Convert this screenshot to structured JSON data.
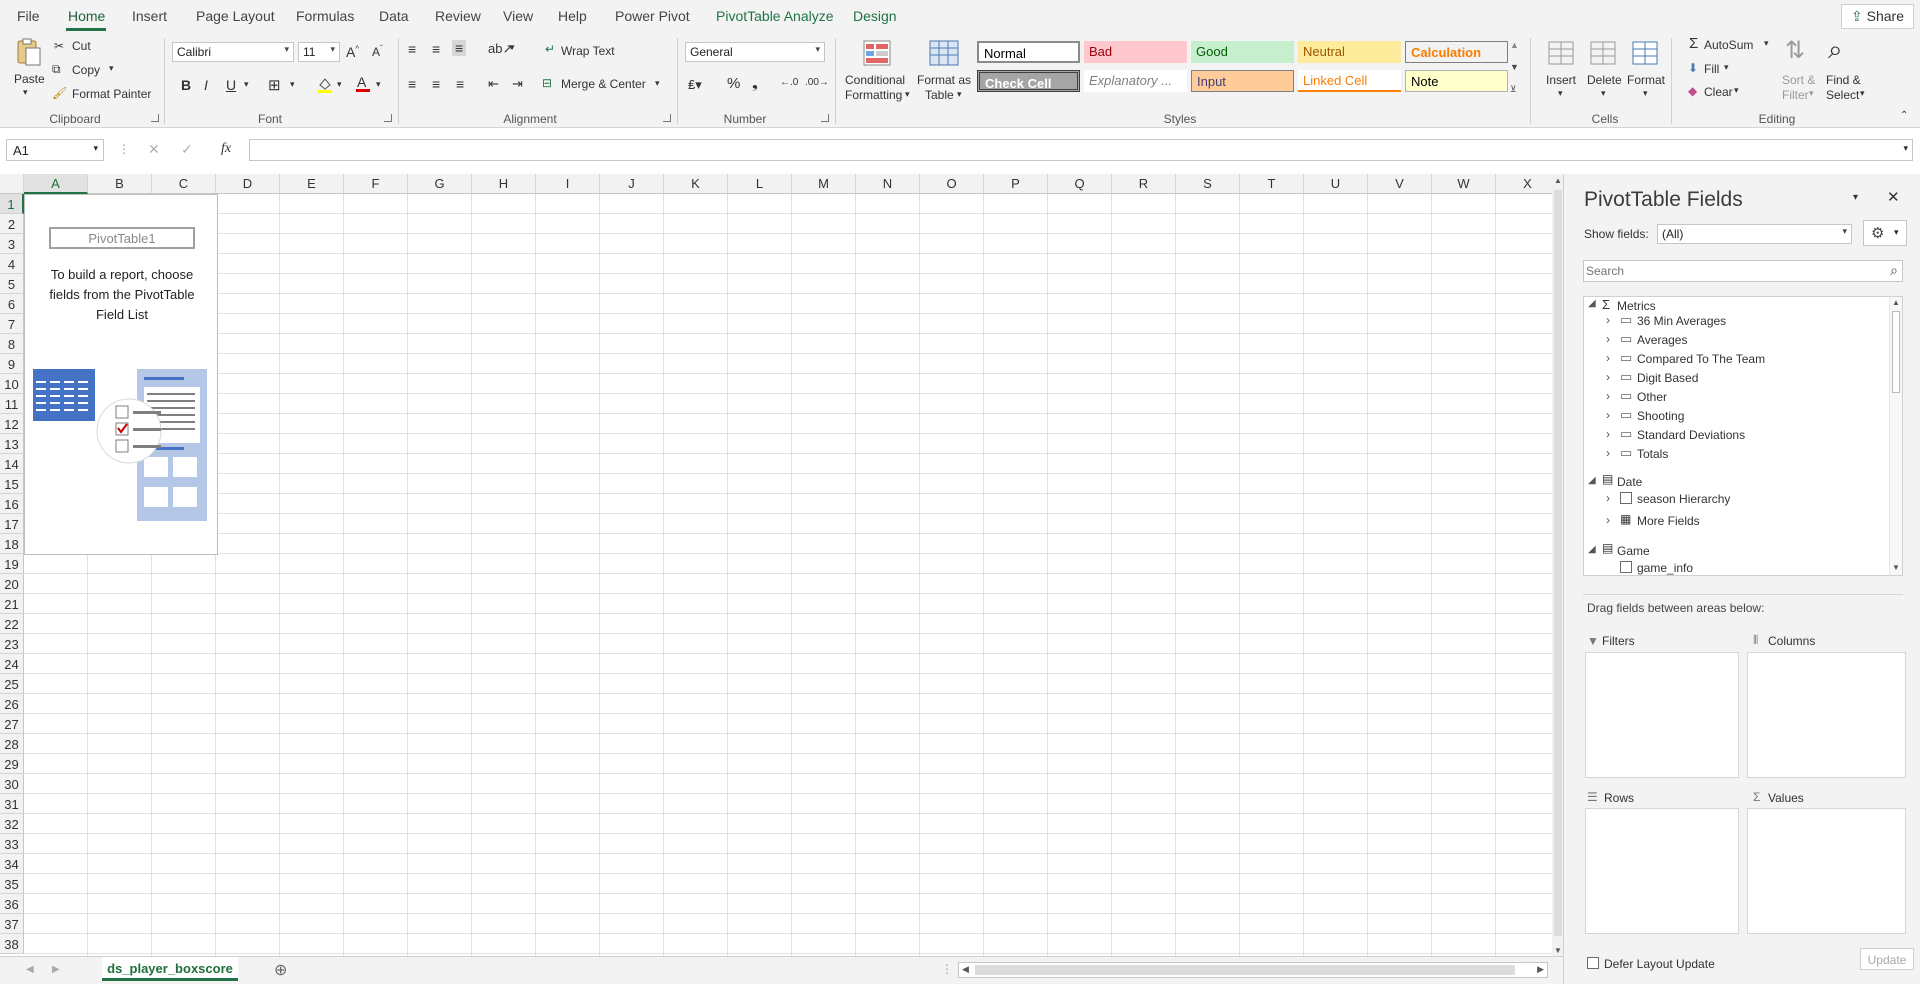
{
  "ribbon_tabs": {
    "file": "File",
    "home": "Home",
    "insert": "Insert",
    "page_layout": "Page Layout",
    "formulas": "Formulas",
    "data": "Data",
    "review": "Review",
    "view": "View",
    "help": "Help",
    "power_pivot": "Power Pivot",
    "pivot_analyze": "PivotTable Analyze",
    "design": "Design"
  },
  "share": "Share",
  "clipboard": {
    "paste": "Paste",
    "cut": "Cut",
    "copy": "Copy",
    "format_painter": "Format Painter",
    "label": "Clipboard"
  },
  "font": {
    "name": "Calibri",
    "size": "11",
    "bold": "B",
    "italic": "I",
    "underline": "U",
    "label": "Font"
  },
  "alignment": {
    "wrap_text": "Wrap Text",
    "merge_center": "Merge & Center",
    "label": "Alignment"
  },
  "number": {
    "format": "General",
    "label": "Number"
  },
  "styles": {
    "conditional_formatting_1": "Conditional",
    "conditional_formatting_2": "Formatting",
    "format_as_table_1": "Format as",
    "format_as_table_2": "Table",
    "normal": "Normal",
    "bad": "Bad",
    "good": "Good",
    "neutral": "Neutral",
    "calculation": "Calculation",
    "check_cell": "Check Cell",
    "explanatory": "Explanatory ...",
    "input": "Input",
    "linked_cell": "Linked Cell",
    "note": "Note",
    "label": "Styles"
  },
  "cells": {
    "insert": "Insert",
    "delete": "Delete",
    "format": "Format",
    "label": "Cells"
  },
  "editing": {
    "autosum": "AutoSum",
    "fill": "Fill",
    "clear": "Clear",
    "sort_1": "Sort &",
    "sort_2": "Filter",
    "find_1": "Find &",
    "find_2": "Select",
    "label": "Editing"
  },
  "formula_bar": {
    "name_box": "A1",
    "fx": "fx",
    "formula": ""
  },
  "columns": [
    "A",
    "B",
    "C",
    "D",
    "E",
    "F",
    "G",
    "H",
    "I",
    "J",
    "K",
    "L",
    "M",
    "N",
    "O",
    "P",
    "Q",
    "R",
    "S",
    "T",
    "U",
    "V",
    "W",
    "X"
  ],
  "rows": [
    "1",
    "2",
    "3",
    "4",
    "5",
    "6",
    "7",
    "8",
    "9",
    "10",
    "11",
    "12",
    "13",
    "14",
    "15",
    "16",
    "17",
    "18",
    "19",
    "20",
    "21",
    "22",
    "23",
    "24",
    "25",
    "26",
    "27",
    "28",
    "29",
    "30",
    "31",
    "32",
    "33",
    "34",
    "35",
    "36",
    "37",
    "38"
  ],
  "pivot_placeholder": {
    "title": "PivotTable1",
    "message": "To build a report, choose fields from the PivotTable Field List"
  },
  "sheet_tab": "ds_player_boxscore",
  "panel": {
    "title": "PivotTable Fields",
    "show_fields_label": "Show fields:",
    "show_fields_value": "(All)",
    "search_placeholder": "Search",
    "metrics": "Metrics",
    "metric_folders": [
      "36 Min Averages",
      "Averages",
      "Compared To The Team",
      "Digit Based",
      "Other",
      "Shooting",
      "Standard Deviations",
      "Totals"
    ],
    "date": "Date",
    "season_hierarchy": "season Hierarchy",
    "more_fields": "More Fields",
    "game": "Game",
    "game_info": "game_info",
    "drag_hint": "Drag fields between areas below:",
    "filters": "Filters",
    "columns": "Columns",
    "rows": "Rows",
    "values": "Values",
    "defer": "Defer Layout Update",
    "update": "Update"
  },
  "colors": {
    "accent": "#217346",
    "bad_bg": "#ffc7ce",
    "bad_fg": "#9c0006",
    "good_bg": "#c6efce",
    "good_fg": "#006100",
    "neutral_bg": "#ffeb9c",
    "neutral_fg": "#9c5700",
    "calc_bg": "#f2f2f2",
    "calc_fg": "#fa7d00",
    "check_bg": "#a5a5a5",
    "input_bg": "#ffcc99",
    "note_bg": "#ffffcc"
  }
}
